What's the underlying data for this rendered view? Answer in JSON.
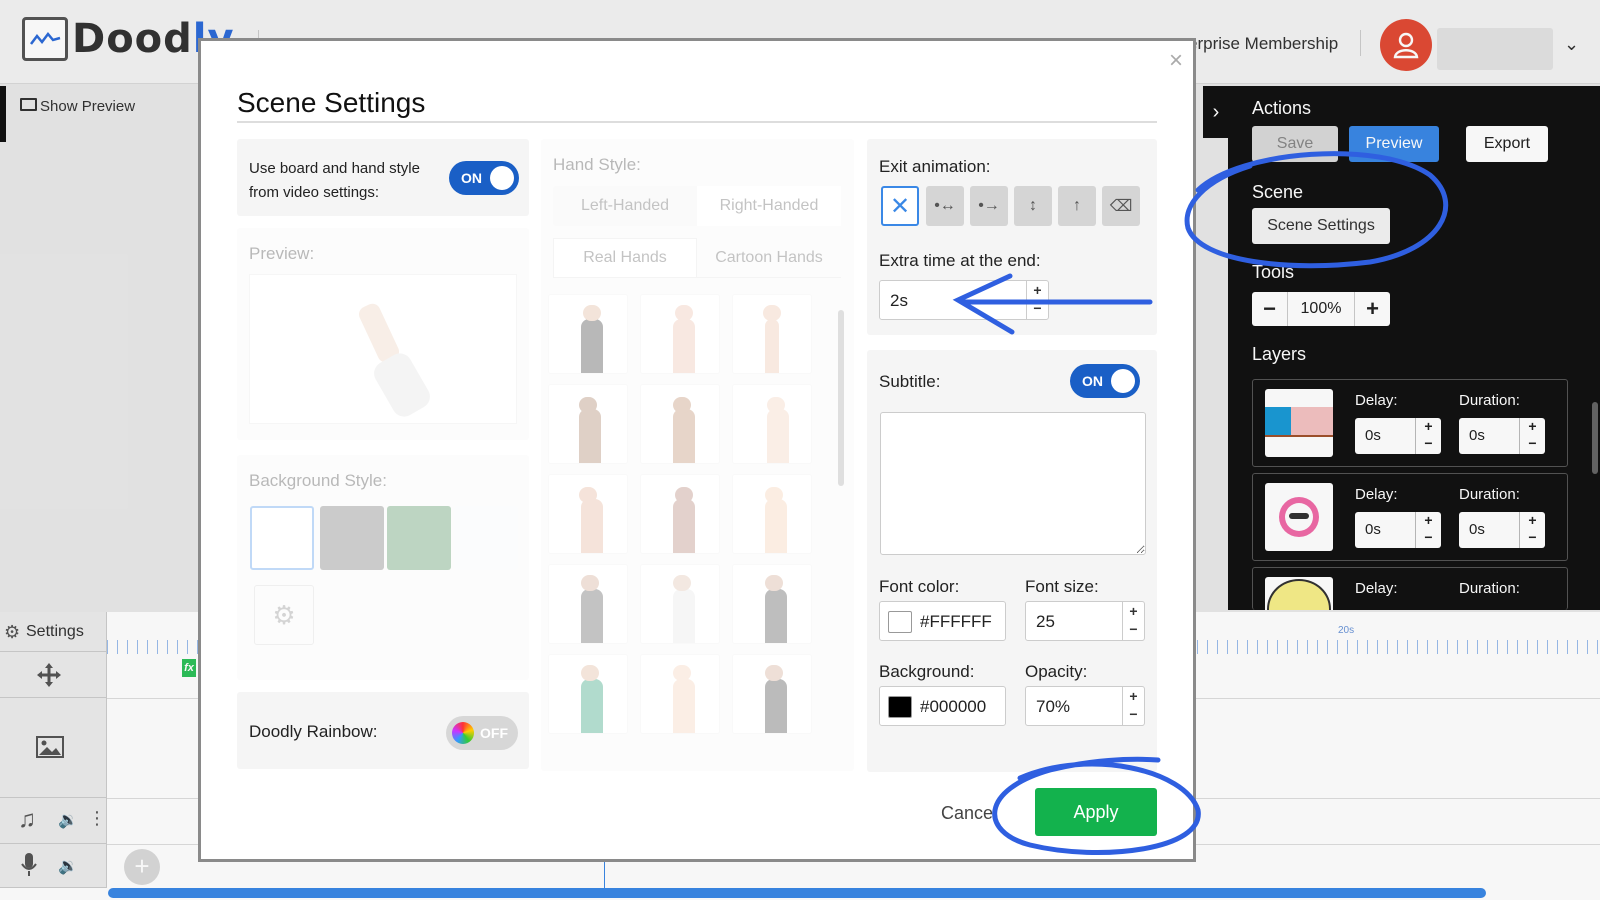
{
  "app": {
    "logo_text_dark": "Dood",
    "logo_text_blue": "ly",
    "membership": "erprise Membership"
  },
  "left": {
    "show_preview": "Show Preview",
    "settings": "Settings"
  },
  "right_panel": {
    "actions_heading": "Actions",
    "save_label": "Save",
    "preview_label": "Preview",
    "export_label": "Export",
    "scene_heading": "Scene",
    "scene_settings_label": "Scene Settings",
    "tools_heading": "Tools",
    "zoom_value": "100%",
    "layers_heading": "Layers",
    "layers": [
      {
        "delay_label": "Delay:",
        "delay": "0s",
        "duration_label": "Duration:",
        "duration": "0s"
      },
      {
        "delay_label": "Delay:",
        "delay": "0s",
        "duration_label": "Duration:",
        "duration": "0s"
      },
      {
        "delay_label": "Delay:",
        "duration_label": "Duration:"
      }
    ]
  },
  "timeline": {
    "ruler_label": "20s"
  },
  "modal": {
    "title": "Scene Settings",
    "close": "×",
    "use_board_label_1": "Use board and hand style",
    "use_board_label_2": "from video settings:",
    "use_board_toggle": "ON",
    "preview_label": "Preview:",
    "background_style_label": "Background Style:",
    "rainbow_label": "Doodly Rainbow:",
    "rainbow_toggle": "OFF",
    "hand_style_label": "Hand Style:",
    "left_handed": "Left-Handed",
    "right_handed": "Right-Handed",
    "real_hands": "Real Hands",
    "cartoon_hands": "Cartoon Hands",
    "exit_animation_label": "Exit animation:",
    "extra_time_label": "Extra time at the end:",
    "extra_time_value": "2s",
    "subtitle_label": "Subtitle:",
    "subtitle_toggle": "ON",
    "font_color_label": "Font color:",
    "font_color_value": "#FFFFFF",
    "font_size_label": "Font size:",
    "font_size_value": "25",
    "background_label": "Background:",
    "background_value": "#000000",
    "opacity_label": "Opacity:",
    "opacity_value": "70%",
    "cancel_label": "Cancel",
    "apply_label": "Apply"
  },
  "colors": {
    "accent_blue": "#3a88e6",
    "toggle_blue": "#1a5fc6",
    "apply_green": "#13b24d",
    "avatar_red": "#e24b35",
    "annotation_blue": "#2f5fe0"
  },
  "icons": [
    "gear-icon",
    "move-icon",
    "image-icon",
    "music-icon",
    "volume-icon",
    "mic-icon",
    "monitor-icon",
    "user-icon",
    "chevron-down-icon",
    "chevron-right-icon",
    "close-icon",
    "plus-icon",
    "minus-icon"
  ]
}
